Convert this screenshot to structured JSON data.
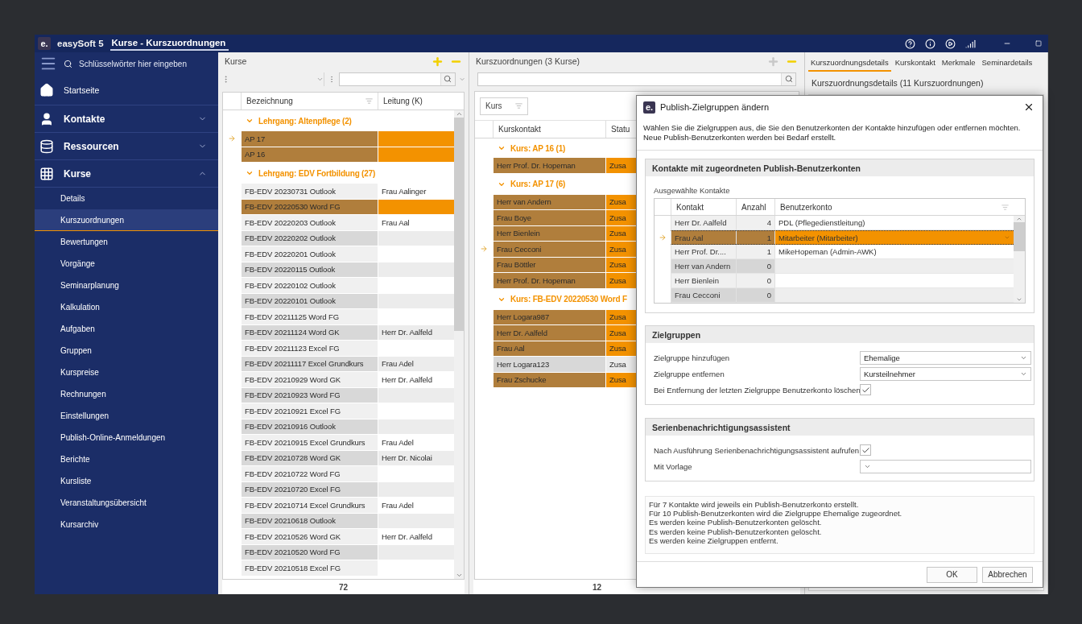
{
  "app": {
    "logo": "e.",
    "name": "easySoft 5",
    "title": "Kurse - Kurszuordnungen"
  },
  "sidebar": {
    "search": {
      "placeholder": "Schlüsselwörter hier eingeben"
    },
    "sections": [
      {
        "label": "Startseite",
        "kind": "home"
      },
      {
        "label": "Kontakte",
        "kind": "contacts",
        "expanded": false
      },
      {
        "label": "Ressourcen",
        "kind": "resources",
        "expanded": false
      },
      {
        "label": "Kurse",
        "kind": "courses",
        "expanded": true,
        "items": [
          {
            "label": "Details",
            "selected": false
          },
          {
            "label": "Kurszuordnungen",
            "selected": true
          },
          {
            "label": "Bewertungen",
            "selected": false
          },
          {
            "label": "Vorgänge",
            "selected": false
          },
          {
            "label": "Seminarplanung",
            "selected": false
          },
          {
            "label": "Kalkulation",
            "selected": false
          },
          {
            "label": "Aufgaben",
            "selected": false
          },
          {
            "label": "Gruppen",
            "selected": false
          },
          {
            "label": "Kurspreise",
            "selected": false
          },
          {
            "label": "Rechnungen",
            "selected": false
          },
          {
            "label": "Einstellungen",
            "selected": false
          },
          {
            "label": "Publish-Online-Anmeldungen",
            "selected": false
          },
          {
            "label": "Berichte",
            "selected": false
          },
          {
            "label": "Kursliste",
            "selected": false
          },
          {
            "label": "Veranstaltungsübersicht",
            "selected": false
          },
          {
            "label": "Kursarchiv",
            "selected": false
          }
        ]
      }
    ]
  },
  "courses_panel": {
    "title": "Kurse",
    "actions": [
      {
        "kind": "add",
        "disabled": false
      },
      {
        "kind": "remove",
        "disabled": false
      }
    ],
    "columns": [
      "Bezeichnung",
      "Leitung (K)"
    ],
    "groups": [
      {
        "label": "Lehrgang: Altenpflege (2)",
        "expanded": true,
        "rows": [
          {
            "name": "AP 17",
            "selected": true,
            "current": true
          },
          {
            "name": "AP 16",
            "selected": true,
            "current": false
          }
        ]
      },
      {
        "label": "Lehrgang: EDV Fortbildung (27)",
        "expanded": true,
        "rows": [
          {
            "name": "FB-EDV 20230731 Outlook",
            "lead": "Frau Aalinger",
            "selected": false,
            "current": false
          },
          {
            "name": "FB-EDV 20220530 Word FG",
            "selected": true,
            "current": false
          },
          {
            "name": "FB-EDV 20220203 Outlook",
            "lead": "Frau Aal",
            "selected": false,
            "current": false
          },
          {
            "name": "FB-EDV 20220202 Outlook",
            "selected": false,
            "current": false
          },
          {
            "name": "FB-EDV 20220201 Outlook",
            "selected": false,
            "current": false
          },
          {
            "name": "FB-EDV 20220115 Outlook",
            "selected": false,
            "current": false
          },
          {
            "name": "FB-EDV 20220102 Outlook",
            "selected": false,
            "current": false
          },
          {
            "name": "FB-EDV 20220101 Outlook",
            "selected": false,
            "current": false
          },
          {
            "name": "FB-EDV 20211125 Word FG",
            "selected": false,
            "current": false
          },
          {
            "name": "FB-EDV 20211124 Word GK",
            "lead": "Herr Dr. Aalfeld",
            "selected": false,
            "current": false
          },
          {
            "name": "FB-EDV 20211123 Excel FG",
            "selected": false,
            "current": false
          },
          {
            "name": "FB-EDV 20211117 Excel Grundkurs",
            "lead": "Frau Adel",
            "selected": false,
            "current": false
          },
          {
            "name": "FB-EDV 20210929 Word GK",
            "lead": "Herr Dr. Aalfeld",
            "selected": false,
            "current": false
          },
          {
            "name": "FB-EDV 20210923 Word FG",
            "selected": false,
            "current": false
          },
          {
            "name": "FB-EDV 20210921 Excel FG",
            "selected": false,
            "current": false
          },
          {
            "name": "FB-EDV 20210916 Outlook",
            "selected": false,
            "current": false
          },
          {
            "name": "FB-EDV 20210915 Excel Grundkurs",
            "lead": "Frau Adel",
            "selected": false,
            "current": false
          },
          {
            "name": "FB-EDV 20210728 Word GK",
            "lead": "Herr Dr. Nicolai",
            "selected": false,
            "current": false
          },
          {
            "name": "FB-EDV 20210722 Word FG",
            "selected": false,
            "current": false
          },
          {
            "name": "FB-EDV 20210720 Excel FG",
            "selected": false,
            "current": false
          },
          {
            "name": "FB-EDV 20210714 Excel Grundkurs",
            "lead": "Frau Adel",
            "selected": false,
            "current": false
          },
          {
            "name": "FB-EDV 20210618 Outlook",
            "selected": false,
            "current": false
          },
          {
            "name": "FB-EDV 20210526 Word GK",
            "lead": "Herr Dr. Aalfeld",
            "selected": false,
            "current": false
          },
          {
            "name": "FB-EDV 20210520 Word FG",
            "selected": false,
            "current": false
          },
          {
            "name": "FB-EDV 20210518 Excel FG",
            "selected": false,
            "current": false
          }
        ]
      }
    ],
    "footer": "72"
  },
  "assignments_panel": {
    "title": "Kurszuordnungen (3 Kurse)",
    "actions": [
      {
        "kind": "add",
        "disabled": true
      },
      {
        "kind": "remove",
        "disabled": false
      }
    ],
    "group_by": "Kurs",
    "columns": [
      "Kurskontakt",
      "Statu"
    ],
    "groups": [
      {
        "label": "Kurs: AP 16 (1)",
        "expanded": true,
        "rows": [
          {
            "contact": "Herr Prof. Dr. Hopeman",
            "status": "Zusa",
            "selected": true,
            "current": false
          }
        ]
      },
      {
        "label": "Kurs: AP 17 (6)",
        "expanded": true,
        "rows": [
          {
            "contact": "Herr van Andern",
            "status": "Zusa",
            "selected": true,
            "current": false
          },
          {
            "contact": "Frau Boye",
            "status": "Zusa",
            "selected": true,
            "current": false
          },
          {
            "contact": "Herr Bienlein",
            "status": "Zusa",
            "selected": true,
            "current": false
          },
          {
            "contact": "Frau Cecconi",
            "status": "Zusa",
            "selected": true,
            "current": true
          },
          {
            "contact": "Frau Böttler",
            "status": "Zusa",
            "selected": true,
            "current": false
          },
          {
            "contact": "Herr Prof. Dr. Hopeman",
            "status": "Zusa",
            "selected": true,
            "current": false
          }
        ]
      },
      {
        "label": "Kurs: FB-EDV 20220530 Word F",
        "expanded": true,
        "rows": [
          {
            "contact": "Herr Logara987",
            "status": "Zusa",
            "selected": true,
            "current": false
          },
          {
            "contact": "Herr Dr. Aalfeld",
            "status": "Zusa",
            "selected": true,
            "current": false
          },
          {
            "contact": "Frau Aal",
            "status": "Zusa",
            "selected": true,
            "current": false
          },
          {
            "contact": "Herr Logara123",
            "status": "Zusa",
            "selected": false,
            "current": false
          },
          {
            "contact": "Frau Zschucke",
            "status": "Zusa",
            "selected": true,
            "current": false
          }
        ]
      }
    ],
    "footer": "12"
  },
  "details_panel": {
    "tabs": [
      {
        "label": "Kurszuordnungsdetails",
        "selected": true
      },
      {
        "label": "Kurskontakt",
        "selected": false
      },
      {
        "label": "Merkmale",
        "selected": false
      },
      {
        "label": "Seminardetails",
        "selected": false
      }
    ],
    "subtitle": "Kurszuordnungsdetails (11 Kurszuordnungen)"
  },
  "dialog": {
    "logo": "e.",
    "title": "Publish-Zielgruppen ändern",
    "description": [
      "Wählen Sie die Zielgruppen aus, die Sie den Benutzerkonten der Kontakte hinzufügen oder entfernen möchten.",
      "Neue Publish-Benutzerkonten werden bei Bedarf erstellt."
    ],
    "contacts_group": {
      "title": "Kontakte mit zugeordneten Publish-Benutzerkonten",
      "label": "Ausgewählte Kontakte",
      "columns": [
        "Kontakt",
        "Anzahl",
        "Benutzerkonto"
      ],
      "rows": [
        {
          "contact": "Herr Dr. Aalfeld",
          "count": "4",
          "account": "PDL (Pflegedienstleitung)",
          "selected": false,
          "current": false
        },
        {
          "contact": "Frau Aal",
          "count": "1",
          "account": "Mitarbeiter (Mitarbeiter)",
          "selected": true,
          "current": true
        },
        {
          "contact": "Herr Prof. Dr....",
          "count": "1",
          "account": "MikeHopeman (Admin-AWK)",
          "selected": false,
          "current": false
        },
        {
          "contact": "Herr van Andern",
          "count": "0",
          "selected": false,
          "current": false
        },
        {
          "contact": "Herr Bienlein",
          "count": "0",
          "selected": false,
          "current": false
        },
        {
          "contact": "Frau Cecconi",
          "count": "0",
          "selected": false,
          "current": false
        }
      ]
    },
    "groups": [
      {
        "title": "Zielgruppen",
        "fields": [
          {
            "kind": "combo",
            "label": "Zielgruppe hinzufügen",
            "value": "Ehemalige"
          },
          {
            "kind": "combo",
            "label": "Zielgruppe entfernen",
            "value": "Kursteilnehmer"
          },
          {
            "kind": "checkbox",
            "label": "Bei Entfernung der letzten Zielgruppe Benutzerkonto löschen",
            "checked": true
          }
        ]
      },
      {
        "title": "Serienbenachrichtigungsassistent",
        "fields": [
          {
            "kind": "checkbox",
            "label": "Nach Ausführung Serienbenachrichtigungsassistent aufrufen",
            "checked": true
          },
          {
            "kind": "combo",
            "label": "Mit Vorlage"
          }
        ]
      }
    ],
    "summary": [
      "Für 7 Kontakte wird jeweils ein Publish-Benutzerkonto erstellt.",
      "Für 10 Publish-Benutzerkonten wird die Zielgruppe Ehemalige zugeordnet.",
      "Es werden keine Publish-Benutzerkonten gelöscht.",
      "Es werden keine Publish-Benutzerkonten gelöscht.",
      "Es werden keine Zielgruppen entfernt."
    ],
    "buttons": [
      "OK",
      "Abbrechen"
    ]
  }
}
